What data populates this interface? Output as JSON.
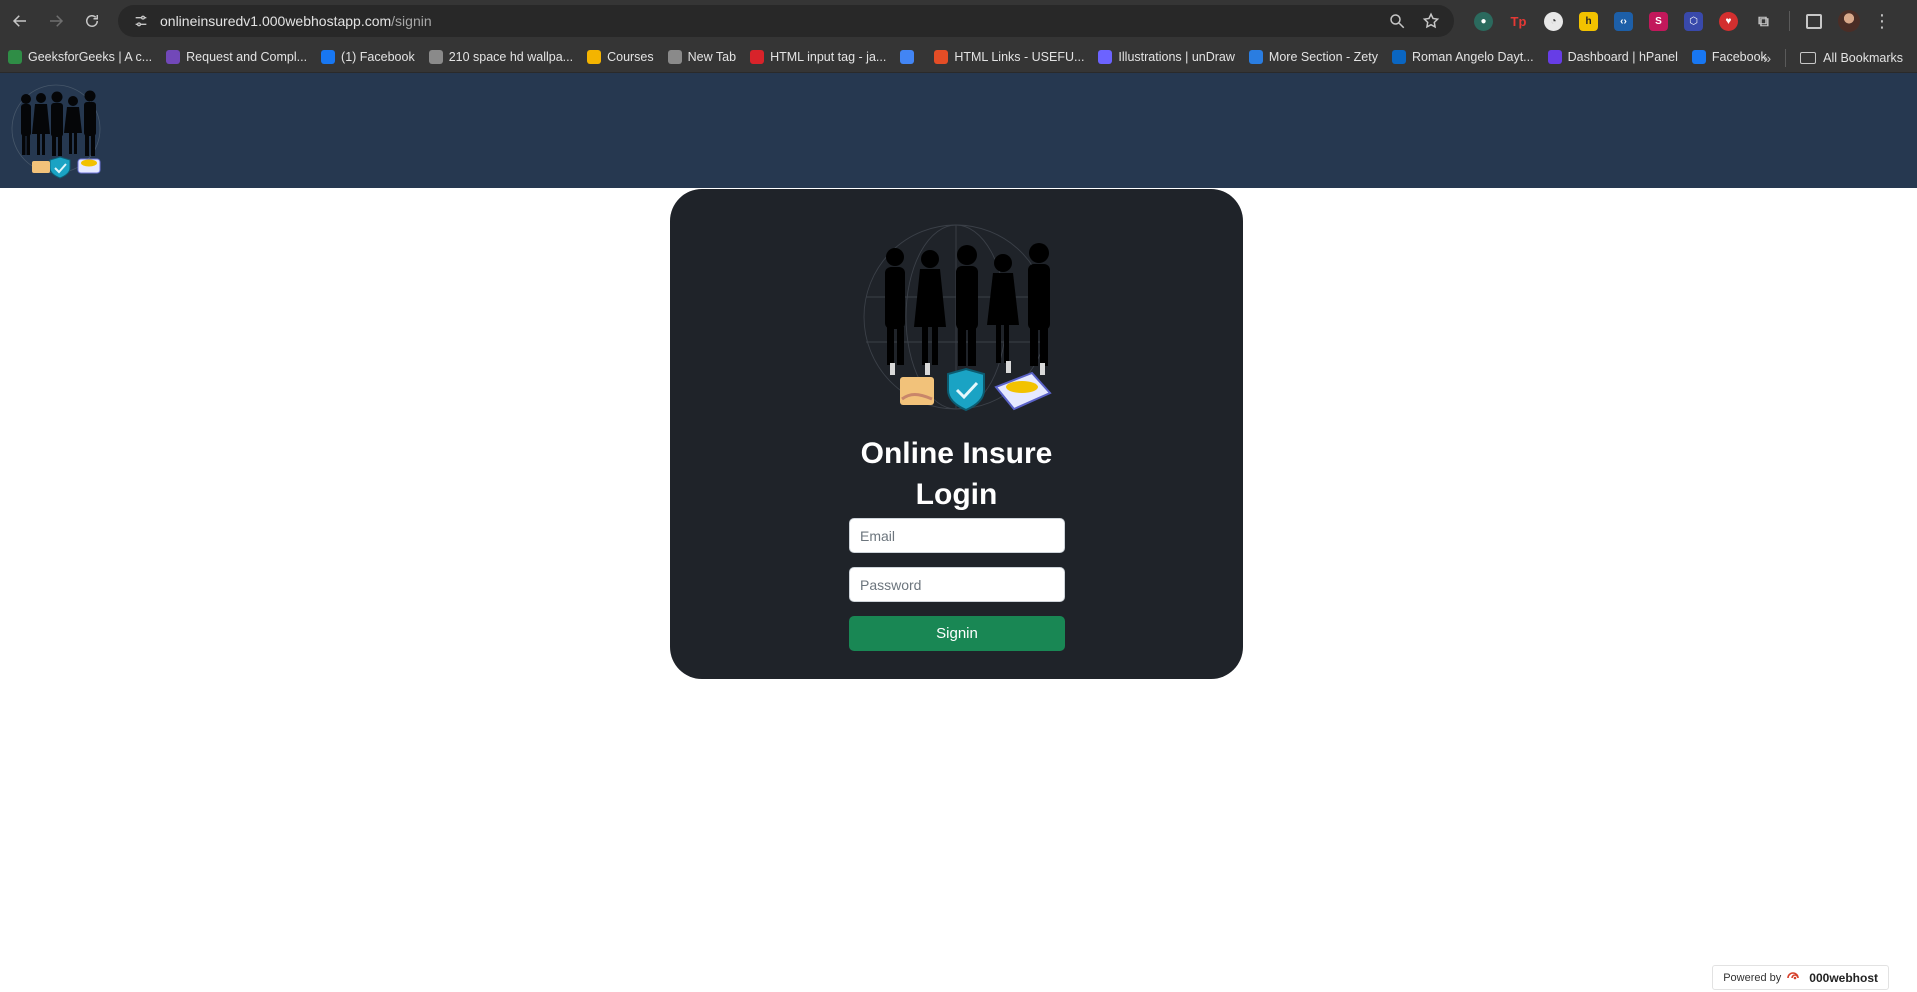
{
  "browser": {
    "url_host": "onlineinsuredv1.000webhostapp.com",
    "url_path": "/signin",
    "bookmarks": [
      {
        "label": "GeeksforGeeks | A c...",
        "icon": "geeksforgeeks-icon",
        "color": "#2f8d46"
      },
      {
        "label": "Request and Compl...",
        "icon": "forms-icon",
        "color": "#7248b9"
      },
      {
        "label": "(1) Facebook",
        "icon": "facebook-icon",
        "color": "#1877f2"
      },
      {
        "label": "210 space hd wallpa...",
        "icon": "globe-icon",
        "color": "#8a8a8a"
      },
      {
        "label": "Courses",
        "icon": "classroom-icon",
        "color": "#f4b400"
      },
      {
        "label": "New Tab",
        "icon": "globe-icon",
        "color": "#8a8a8a"
      },
      {
        "label": "HTML input tag - ja...",
        "icon": "javatpoint-icon",
        "color": "#d8232a"
      },
      {
        "label": "",
        "icon": "table-icon",
        "color": "#4285f4"
      },
      {
        "label": "HTML Links - USEFU...",
        "icon": "html-icon",
        "color": "#e44d26"
      },
      {
        "label": "Illustrations | unDraw",
        "icon": "undraw-icon",
        "color": "#6c63ff"
      },
      {
        "label": "More Section - Zety",
        "icon": "zety-icon",
        "color": "#2a7de1"
      },
      {
        "label": "Roman Angelo Dayt...",
        "icon": "linkedin-icon",
        "color": "#0a66c2"
      },
      {
        "label": "Dashboard | hPanel",
        "icon": "hostinger-icon",
        "color": "#673de6"
      },
      {
        "label": "Facebook",
        "icon": "facebook-icon",
        "color": "#1877f2"
      }
    ],
    "all_bookmarks_label": "All Bookmarks"
  },
  "login": {
    "title_line1": "Online Insure",
    "title_line2": "Login",
    "email_placeholder": "Email",
    "password_placeholder": "Password",
    "submit_label": "Signin"
  },
  "footer": {
    "powered_by": "Powered by",
    "brand": "000webhost"
  },
  "colors": {
    "header_bg": "#263850",
    "card_bg": "#1f2329",
    "button_bg": "#198754"
  }
}
